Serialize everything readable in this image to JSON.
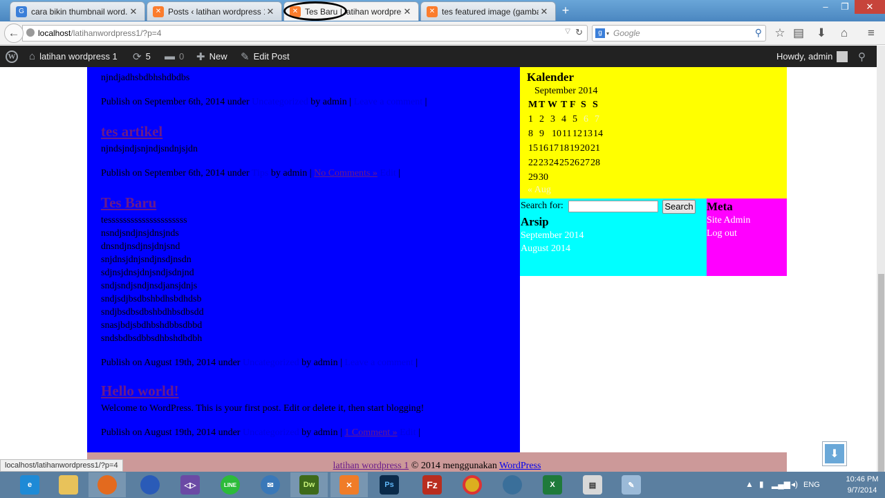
{
  "browser": {
    "tabs": [
      {
        "label": "cara bikin thumbnail word...",
        "favicon": "G",
        "active": false
      },
      {
        "label": "Posts ‹ latihan wordpress 1 ...",
        "favicon": "xampp",
        "active": false
      },
      {
        "label": "Tes Baru | latihan wordpress...",
        "favicon": "xampp",
        "active": true
      },
      {
        "label": "tes featured image (gamba...",
        "favicon": "xampp",
        "active": false
      }
    ],
    "new_tab": "+",
    "url_host": "localhost",
    "url_path": "/latihanwordpress1/?p=4",
    "search_placeholder": "Google",
    "status_url": "localhost/latihanwordpress1/?p=4"
  },
  "adminbar": {
    "site_name": "latihan wordpress 1",
    "updates": "5",
    "comments": "0",
    "new_label": "New",
    "edit_label": "Edit Post",
    "howdy": "Howdy, admin"
  },
  "posts": [
    {
      "lines": [
        "njndjadhsbdbhshdbdbs"
      ],
      "meta_prefix": "Publish on September 6th, 2014 under",
      "meta_by": "by admin |",
      "meta_end": "|"
    },
    {
      "title": "tes artikel",
      "lines": [
        "njndsjndjsnjndjsndnjsjdn"
      ],
      "meta_prefix": "Publish on September 6th, 2014 under",
      "meta_by": "by admin |",
      "comments": "No Comments »",
      "meta_end": "|"
    },
    {
      "title": "Tes Baru",
      "lines": [
        "tesssssssssssssssssssss",
        "nsndjsndjnsjdnsjnds",
        "dnsndjnsdjnsjdnjsnd",
        "snjdnsjdnjsndjnsdjnsdn",
        "sdjnsjdnsjdnjsndjsdnjnd",
        "sndjsndjsndjnsdjansjdnjs",
        "sndjsdjbsdbshbdhsbdhdsb",
        "sndjbsdbsdbshbdhbsdbsdd",
        "snasjbdjsbdhbshdbbsdbbd",
        "sndsbdbsdbbsdhbshdbdbh"
      ],
      "meta_prefix": "Publish on August 19th, 2014 under",
      "meta_by": "by admin |",
      "meta_end": "|"
    },
    {
      "title": "Hello world!",
      "lines": [
        "Welcome to WordPress. This is your first post. Edit or delete it, then start blogging!"
      ],
      "meta_prefix": "Publish on August 19th, 2014 under",
      "meta_by": "by admin |",
      "comments": "1 Comment »",
      "meta_end": "|"
    }
  ],
  "calendar": {
    "title": "Kalender",
    "caption": "September 2014",
    "headers": [
      "M",
      "T",
      "W",
      "T",
      "F",
      "S",
      "S"
    ],
    "weeks": [
      [
        "1",
        "2",
        "3",
        "4",
        "5",
        "6",
        "7"
      ],
      [
        "8",
        "9",
        "10",
        "11",
        "12",
        "13",
        "14"
      ],
      [
        "15",
        "16",
        "17",
        "18",
        "19",
        "20",
        "21"
      ],
      [
        "22",
        "23",
        "24",
        "25",
        "26",
        "27",
        "28"
      ],
      [
        "29",
        "30",
        "",
        "",
        "",
        "",
        ""
      ]
    ],
    "light_days": [
      "6",
      "7"
    ],
    "prev": "« Aug"
  },
  "search_widget": {
    "label": "Search for:",
    "button": "Search"
  },
  "arsip": {
    "title": "Arsip",
    "items": [
      "September 2014",
      "August 2014"
    ]
  },
  "meta_widget": {
    "title": "Meta",
    "items": [
      "Site Admin",
      "Log out"
    ]
  },
  "footer": {
    "site_link": "latihan wordpress 1",
    "middle": " © 2014 menggunakan ",
    "wp_link": "WordPress"
  },
  "taskbar": {
    "apps": [
      "ie",
      "explorer",
      "firefox",
      "app-blue",
      "visual-studio",
      "line",
      "thunderbird",
      "dreamweaver",
      "xampp",
      "photoshop",
      "filezilla",
      "chrome",
      "app-globe",
      "excel",
      "app-printer",
      "paint"
    ],
    "lang": "ENG",
    "time": "10:46 PM",
    "date": "9/7/2014"
  },
  "colors": {
    "content_bg": "#0000ff",
    "calendar_bg": "#ffff00",
    "search_bg": "#00ffff",
    "meta_bg": "#ff00ff",
    "footer_bg": "#cc9999",
    "adminbar_bg": "#222222"
  }
}
